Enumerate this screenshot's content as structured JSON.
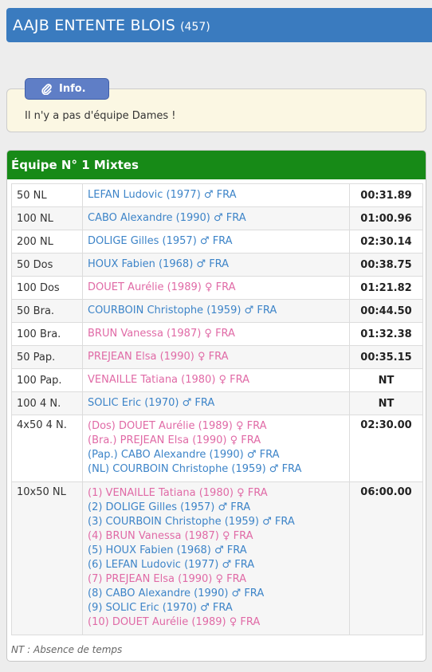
{
  "club": {
    "name": "AAJB ENTENTE BLOIS",
    "code": "(457)"
  },
  "info": {
    "label": "Info.",
    "message": "Il n'y a pas d'équipe Dames !"
  },
  "team": {
    "title": "Équipe N° 1 Mixtes"
  },
  "colors": {
    "header": "#3a7bbf",
    "team_bar": "#178a17",
    "male": "#3d84c8",
    "female": "#e06aa6"
  },
  "results": [
    {
      "event": "50 NL",
      "swimmers": [
        {
          "text": "LEFAN Ludovic (1977) ♂ FRA",
          "gender": "male"
        }
      ],
      "time": "00:31.89"
    },
    {
      "event": "100 NL",
      "swimmers": [
        {
          "text": "CABO Alexandre (1990) ♂ FRA",
          "gender": "male"
        }
      ],
      "time": "01:00.96"
    },
    {
      "event": "200 NL",
      "swimmers": [
        {
          "text": "DOLIGE Gilles (1957) ♂ FRA",
          "gender": "male"
        }
      ],
      "time": "02:30.14"
    },
    {
      "event": "50 Dos",
      "swimmers": [
        {
          "text": "HOUX Fabien (1968) ♂ FRA",
          "gender": "male"
        }
      ],
      "time": "00:38.75"
    },
    {
      "event": "100 Dos",
      "swimmers": [
        {
          "text": "DOUET Aurélie (1989) ♀ FRA",
          "gender": "female"
        }
      ],
      "time": "01:21.82"
    },
    {
      "event": "50 Bra.",
      "swimmers": [
        {
          "text": "COURBOIN Christophe (1959) ♂ FRA",
          "gender": "male"
        }
      ],
      "time": "00:44.50"
    },
    {
      "event": "100 Bra.",
      "swimmers": [
        {
          "text": "BRUN Vanessa (1987) ♀ FRA",
          "gender": "female"
        }
      ],
      "time": "01:32.38"
    },
    {
      "event": "50 Pap.",
      "swimmers": [
        {
          "text": "PREJEAN Elsa (1990) ♀ FRA",
          "gender": "female"
        }
      ],
      "time": "00:35.15"
    },
    {
      "event": "100 Pap.",
      "swimmers": [
        {
          "text": "VENAILLE Tatiana (1980) ♀ FRA",
          "gender": "female"
        }
      ],
      "time": "NT"
    },
    {
      "event": "100 4 N.",
      "swimmers": [
        {
          "text": "SOLIC Eric (1970) ♂ FRA",
          "gender": "male"
        }
      ],
      "time": "NT"
    },
    {
      "event": "4x50 4 N.",
      "swimmers": [
        {
          "text": "(Dos) DOUET Aurélie (1989) ♀ FRA",
          "gender": "female"
        },
        {
          "text": "(Bra.) PREJEAN Elsa (1990) ♀ FRA",
          "gender": "female"
        },
        {
          "text": "(Pap.) CABO Alexandre (1990) ♂ FRA",
          "gender": "male"
        },
        {
          "text": "(NL) COURBOIN Christophe (1959) ♂ FRA",
          "gender": "male"
        }
      ],
      "time": "02:30.00"
    },
    {
      "event": "10x50 NL",
      "swimmers": [
        {
          "text": "(1) VENAILLE Tatiana (1980) ♀ FRA",
          "gender": "female"
        },
        {
          "text": "(2) DOLIGE Gilles (1957) ♂ FRA",
          "gender": "male"
        },
        {
          "text": "(3) COURBOIN Christophe (1959) ♂ FRA",
          "gender": "male"
        },
        {
          "text": "(4) BRUN Vanessa (1987) ♀ FRA",
          "gender": "female"
        },
        {
          "text": "(5) HOUX Fabien (1968) ♂ FRA",
          "gender": "male"
        },
        {
          "text": "(6) LEFAN Ludovic (1977) ♂ FRA",
          "gender": "male"
        },
        {
          "text": "(7) PREJEAN Elsa (1990) ♀ FRA",
          "gender": "female"
        },
        {
          "text": "(8) CABO Alexandre (1990) ♂ FRA",
          "gender": "male"
        },
        {
          "text": "(9) SOLIC Eric (1970) ♂ FRA",
          "gender": "male"
        },
        {
          "text": "(10) DOUET Aurélie (1989) ♀ FRA",
          "gender": "female"
        }
      ],
      "time": "06:00.00"
    }
  ],
  "legend": "NT : Absence de temps"
}
